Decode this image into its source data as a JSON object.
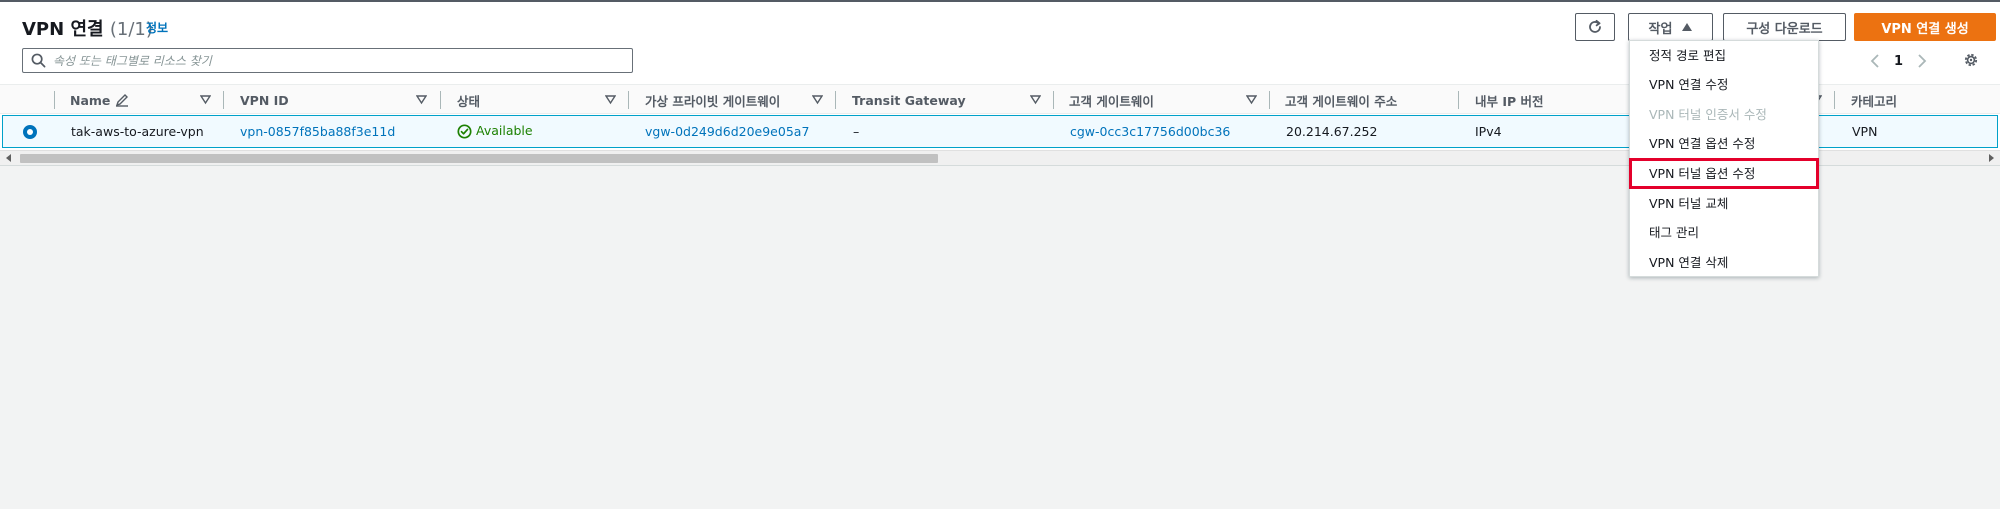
{
  "header": {
    "title": "VPN 연결",
    "count": "(1/1)",
    "info_label": "정보"
  },
  "search": {
    "placeholder": "속성 또는 태그별로 리소스 찾기",
    "value": ""
  },
  "toolbar": {
    "actions_label": "작업",
    "download_label": "구성 다운로드",
    "create_label": "VPN 연결 생성"
  },
  "pagination": {
    "current_page": "1"
  },
  "table": {
    "columns": [
      "Name",
      "VPN ID",
      "상태",
      "가상 프라이빗 게이트웨이",
      "Transit Gateway",
      "고객 게이트웨이",
      "고객 게이트웨이 주소",
      "내부 IP 버전",
      "카테고리"
    ],
    "rows": [
      {
        "name": "tak-aws-to-azure-vpn",
        "vpn_id": "vpn-0857f85ba88f3e11d",
        "status": "Available",
        "vgw": "vgw-0d249d6d20e9e05a7",
        "tgw": "–",
        "cgw": "cgw-0cc3c17756d00bc36",
        "cgw_address": "20.214.67.252",
        "ip_version": "IPv4",
        "category": "VPN"
      }
    ]
  },
  "actions_menu": {
    "items": [
      {
        "label": "정적 경로 편집",
        "disabled": false
      },
      {
        "label": "VPN 연결 수정",
        "disabled": false
      },
      {
        "label": "VPN 터널 인증서 수정",
        "disabled": true
      },
      {
        "label": "VPN 연결 옵션 수정",
        "disabled": false
      },
      {
        "label": "VPN 터널 옵션 수정",
        "disabled": false,
        "highlighted": true
      },
      {
        "label": "VPN 터널 교체",
        "disabled": false
      },
      {
        "label": "태그 관리",
        "disabled": false
      },
      {
        "label": "VPN 연결 삭제",
        "disabled": false
      }
    ]
  },
  "colors": {
    "primary_button": "#ec7211",
    "link": "#0073bb",
    "status_ok": "#1d8102",
    "selected_row_border": "#00a1c9",
    "highlight_box": "#e4002b"
  },
  "icons": [
    "refresh-icon",
    "caret-up-icon",
    "search-icon",
    "chevron-left-icon",
    "chevron-right-icon",
    "gear-icon",
    "edit-icon",
    "sort-icon",
    "check-circle-icon"
  ]
}
